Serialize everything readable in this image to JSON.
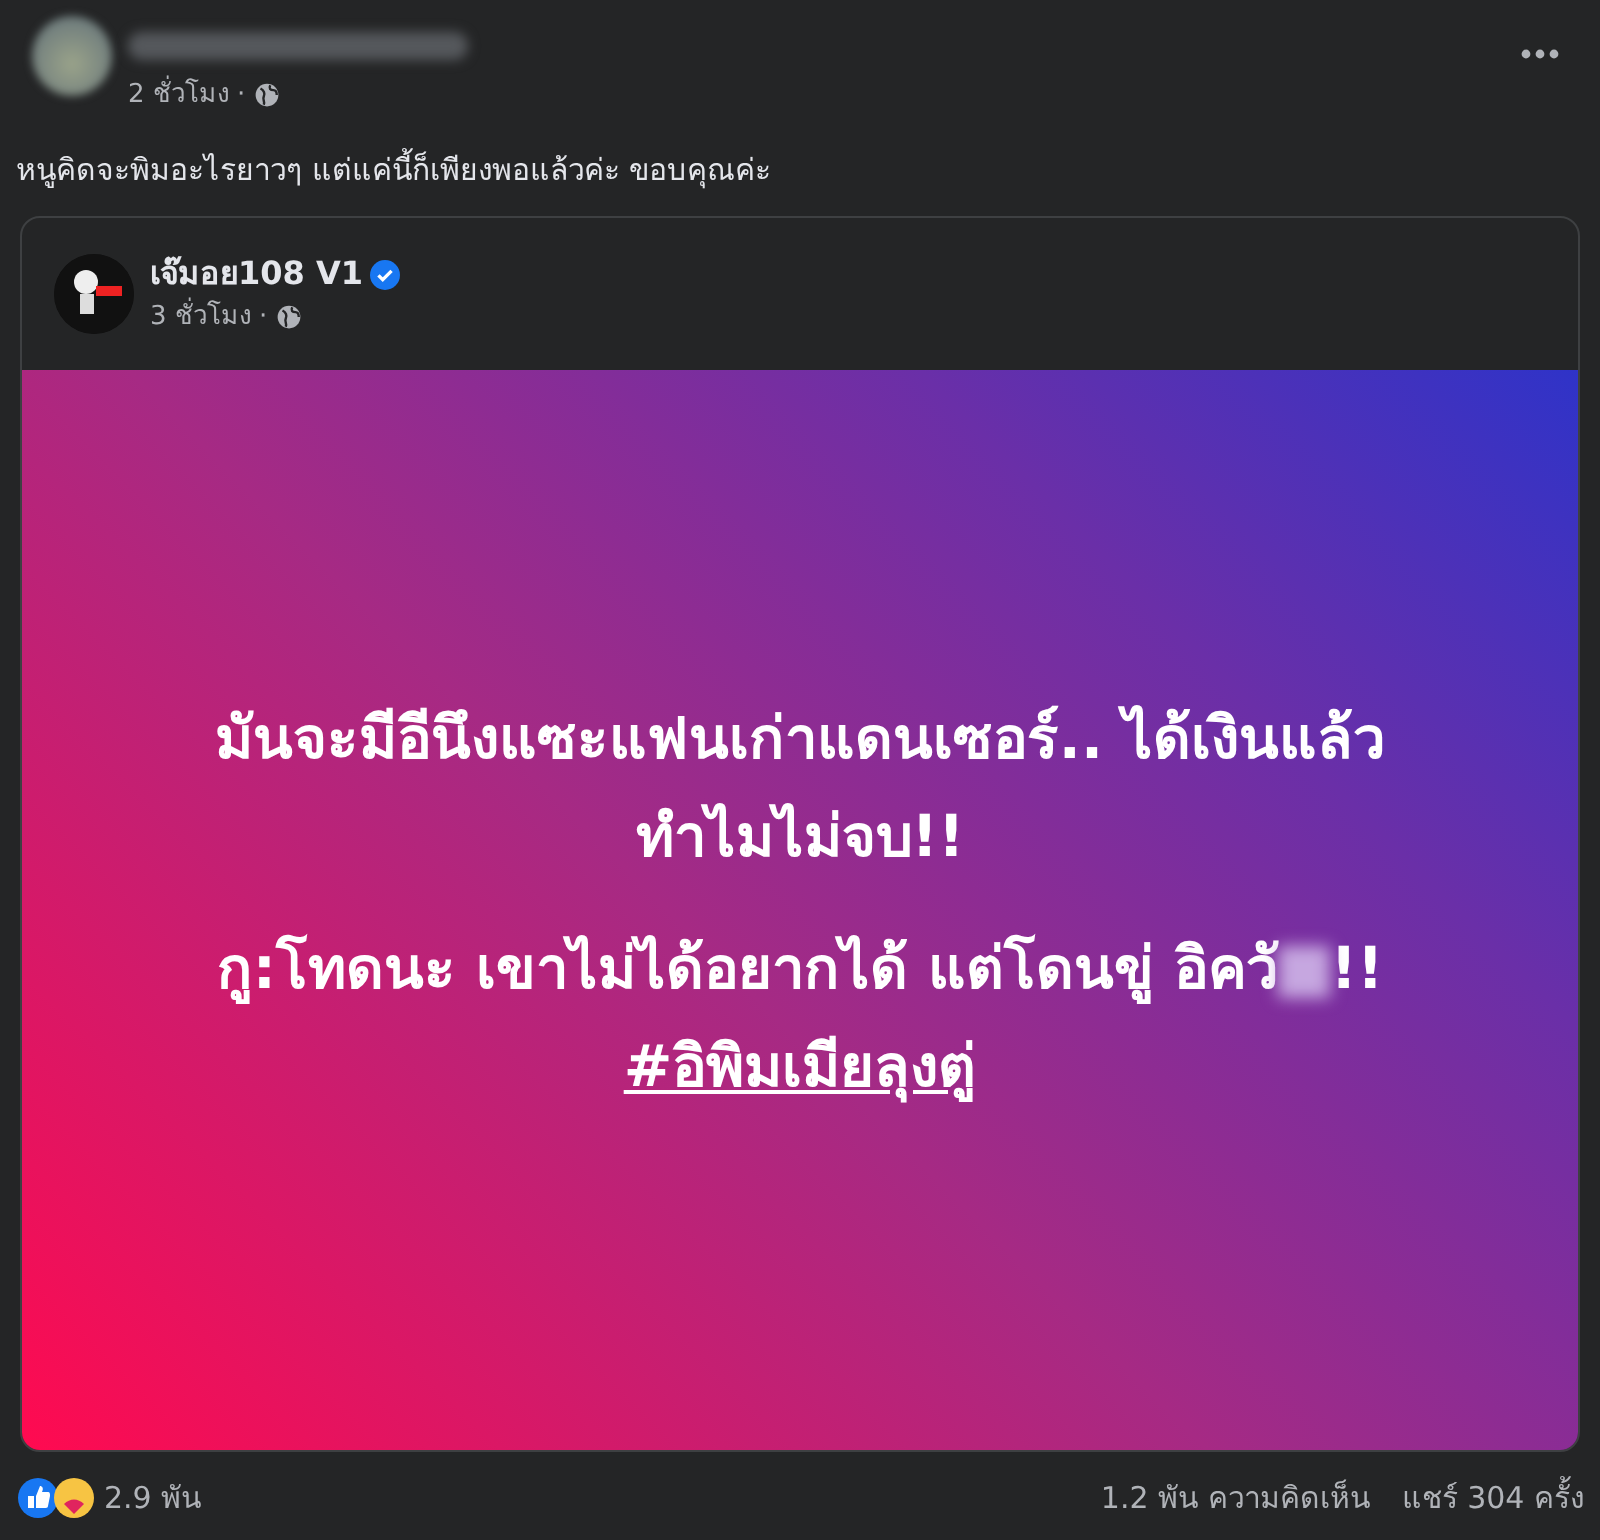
{
  "post": {
    "time": "2 ชั่วโมง ·",
    "text": "หนูคิดจะพิมอะไรยาวๆ แต่แค่นี้ก็เพียงพอแล้วค่ะ ขอบคุณค่ะ"
  },
  "shared_post": {
    "author": "เจ๊มอย108 V1",
    "verified": true,
    "time": "3 ชั่วโมง ·",
    "lines": [
      {
        "kind": "text",
        "text": "มันจะมีอีนึงแซะแฟนเก่าแดนเซอร์.. ได้เงินแล้ว"
      },
      {
        "kind": "text",
        "text": "ทำไมไม่จบ!!"
      },
      {
        "kind": "censored",
        "before": "กู:โทดนะ เขาไม่ได้อยากได้ แต่โดนขู่ อิควั",
        "after": "!!"
      },
      {
        "kind": "hashtag",
        "text": "#อิพิมเมียลุงตู่"
      }
    ]
  },
  "footer": {
    "reactions": "2.9 พัน",
    "comments": "1.2 พัน ความคิดเห็น",
    "shares": "แชร์ 304 ครั้ง"
  }
}
